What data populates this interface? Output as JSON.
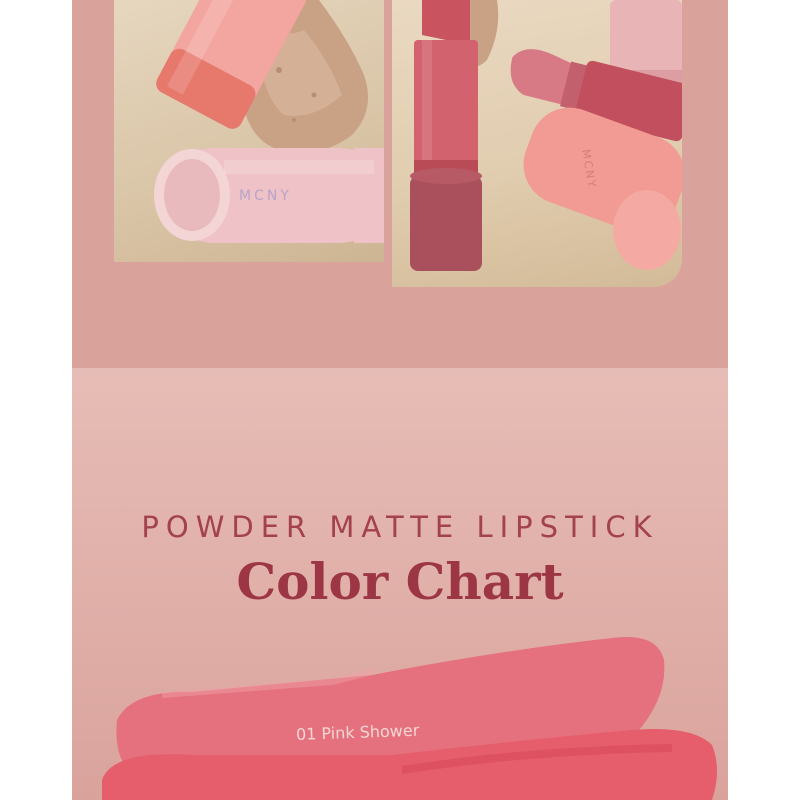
{
  "product": {
    "subtitle": "POWDER MATTE LIPSTICK",
    "title": "Color Chart"
  },
  "photos": {
    "left_brand_mark": "MCNY",
    "right_brand_mark": "MCNY"
  },
  "swatches": [
    {
      "label": "01 Pink Shower",
      "color": "#e4717d"
    }
  ],
  "colors": {
    "top_band": "#d9a29a",
    "bottom_band": "#e6bdb6",
    "title": "#9c3644",
    "swatch_pink": "#e4717d",
    "swatch_red": "#d94a58"
  }
}
